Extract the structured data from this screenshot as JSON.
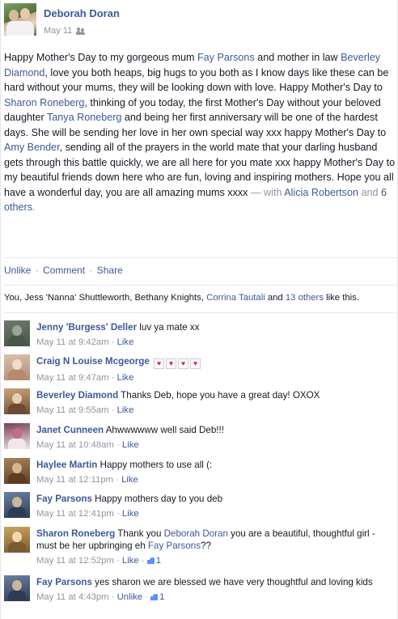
{
  "post": {
    "author": "Deborah Doran",
    "date": "May 11",
    "audience_icon": "friends-icon",
    "text_parts": [
      {
        "t": "Happy Mother's Day to my gorgeous mum "
      },
      {
        "l": "Fay Parsons"
      },
      {
        "t": " and mother in law "
      },
      {
        "l": "Beverley Diamond"
      },
      {
        "t": ", love you both heaps, big hugs to you both as I know days like these can be hard without your mums, they will be looking down with love. Happy Mother's Day to "
      },
      {
        "l": "Sharon Roneberg"
      },
      {
        "t": ", thinking of you today, the first Mother's Day without your beloved daughter "
      },
      {
        "l": "Tanya Roneberg"
      },
      {
        "t": " and being her first anniversary will be one of the hardest days. She will be sending her love in her own special way xxx happy Mother's Day to "
      },
      {
        "l": "Amy Bender"
      },
      {
        "t": ", sending all of the prayers in the world mate that your darling husband gets through this battle quickly, we are all here for you mate xxx happy Mother's Day to my beautiful friends down here who are fun, loving and inspiring mothers. Hope you all have a wonderful day, you are all amazing mums xxxx"
      },
      {
        "m": " — with "
      },
      {
        "l": "Alicia Robertson"
      },
      {
        "m": " and "
      },
      {
        "l": "6 others"
      },
      {
        "m": "."
      }
    ]
  },
  "actions": {
    "unlike": "Unlike",
    "comment": "Comment",
    "share": "Share",
    "separator": "·"
  },
  "likes": {
    "prefix": "You, Jess 'Nanna' Shuttleworth, Bethany Knights, ",
    "name": "Corrina Tautali",
    "and": " and ",
    "others": "13 others",
    "suffix": " like this."
  },
  "comments": [
    {
      "author": "Jenny 'Burgess' Deller",
      "text": " luv ya mate xx",
      "time": "May 11 at 9:42am",
      "action": "Like"
    },
    {
      "author": "Craig N Louise Mcgeorge",
      "text": "",
      "hearts": 4,
      "time": "May 11 at 9:47am",
      "action": "Like"
    },
    {
      "author": "Beverley Diamond",
      "text": " Thanks Deb, hope you have a great day! OXOX",
      "time": "May 11 at 9:55am",
      "action": "Like"
    },
    {
      "author": "Janet Cunneen",
      "text": " Ahwwwwww well said Deb!!!",
      "time": "May 11 at 10:48am",
      "action": "Like"
    },
    {
      "author": "Haylee Martin",
      "text": " Happy mothers to use all (:",
      "time": "May 11 at 12:11pm",
      "action": "Like"
    },
    {
      "author": "Fay Parsons",
      "text": " Happy mothers day to you deb",
      "time": "May 11 at 12:41pm",
      "action": "Like"
    },
    {
      "author": "Sharon Roneberg",
      "text": " Thank you ",
      "mention": "Deborah Doran",
      "text2": " you are a beautiful, thoughtful girl - must be her upbringing eh ",
      "mention2": "Fay Parsons",
      "text3": "??",
      "time": "May 11 at 12:52pm",
      "action": "Like",
      "like_count": "1"
    },
    {
      "author": "Fay Parsons",
      "text": " yes sharon we are blessed we have very thoughtful and loving kids",
      "time": "May 11 at 4:43pm",
      "action": "Unlike",
      "like_count": "1"
    }
  ],
  "colors": {
    "link": "#3b5998",
    "meta": "#90949c",
    "text": "#141823",
    "heart": "#e0245e",
    "like_thumb": "#5890ff"
  }
}
